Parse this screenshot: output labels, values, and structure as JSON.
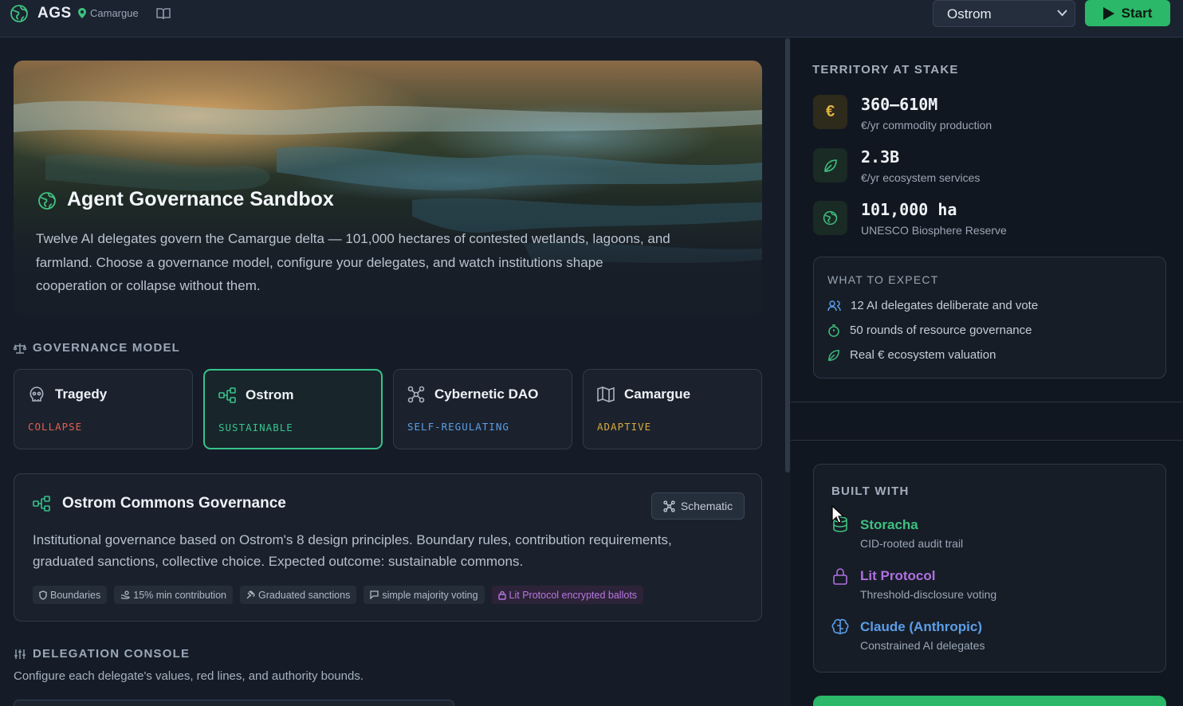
{
  "header": {
    "brand": "AGS",
    "location": "Camargue",
    "model_select": "Ostrom",
    "start_label": "Start"
  },
  "hero": {
    "title": "Agent Governance Sandbox",
    "description": "Twelve AI delegates govern the Camargue delta — 101,000 hectares of contested wetlands, lagoons, and farmland. Choose a governance model, configure your delegates, and watch institutions shape cooperation or collapse without them."
  },
  "governance": {
    "section_label": "GOVERNANCE MODEL",
    "models": [
      {
        "name": "Tragedy",
        "tag": "COLLAPSE",
        "tag_color": "#e0604f",
        "icon": "skull-icon"
      },
      {
        "name": "Ostrom",
        "tag": "SUSTAINABLE",
        "tag_color": "#35c38c",
        "icon": "network-icon",
        "selected": true
      },
      {
        "name": "Cybernetic DAO",
        "tag": "SELF-REGULATING",
        "tag_color": "#5b9ee8",
        "icon": "nodes-icon"
      },
      {
        "name": "Camargue",
        "tag": "ADAPTIVE",
        "tag_color": "#d6a93e",
        "icon": "map-icon"
      }
    ]
  },
  "ostrom_panel": {
    "title": "Ostrom Commons Governance",
    "schematic_label": "Schematic",
    "description": "Institutional governance based on Ostrom's 8 design principles. Boundary rules, contribution requirements, graduated sanctions, collective choice. Expected outcome: sustainable commons.",
    "chips": [
      "Boundaries",
      "15% min contribution",
      "Graduated sanctions",
      "simple majority voting",
      "Lit Protocol encrypted ballots"
    ]
  },
  "delegation": {
    "section_label": "DELEGATION CONSOLE",
    "description": "Configure each delegate's values, red lines, and authority bounds."
  },
  "territory": {
    "section_label": "TERRITORY AT STAKE",
    "stats": [
      {
        "value": "360–610M",
        "sub": "€/yr commodity production",
        "icon": "euro-icon",
        "color": "#e2b340"
      },
      {
        "value": "2.3B",
        "sub": "€/yr ecosystem services",
        "icon": "leaf-icon",
        "color": "#3fc07f"
      },
      {
        "value": "101,000 ha",
        "sub": "UNESCO Biosphere Reserve",
        "icon": "globe-icon",
        "color": "#3fc07f"
      }
    ]
  },
  "expect": {
    "section_label": "WHAT TO EXPECT",
    "items": [
      {
        "text": "12 AI delegates deliberate and vote",
        "icon": "users-icon"
      },
      {
        "text": "50 rounds of resource governance",
        "icon": "timer-icon"
      },
      {
        "text": "Real € ecosystem valuation",
        "icon": "leaf-icon"
      }
    ]
  },
  "built_with": {
    "section_label": "BUILT WITH",
    "items": [
      {
        "name": "Storacha",
        "sub": "CID-rooted audit trail",
        "color": "#3fc07f",
        "icon": "database-icon"
      },
      {
        "name": "Lit Protocol",
        "sub": "Threshold-disclosure voting",
        "color": "#b06fe0",
        "icon": "lock-icon"
      },
      {
        "name": "Claude (Anthropic)",
        "sub": "Constrained AI delegates",
        "color": "#5b9ee8",
        "icon": "brain-icon"
      }
    ]
  }
}
